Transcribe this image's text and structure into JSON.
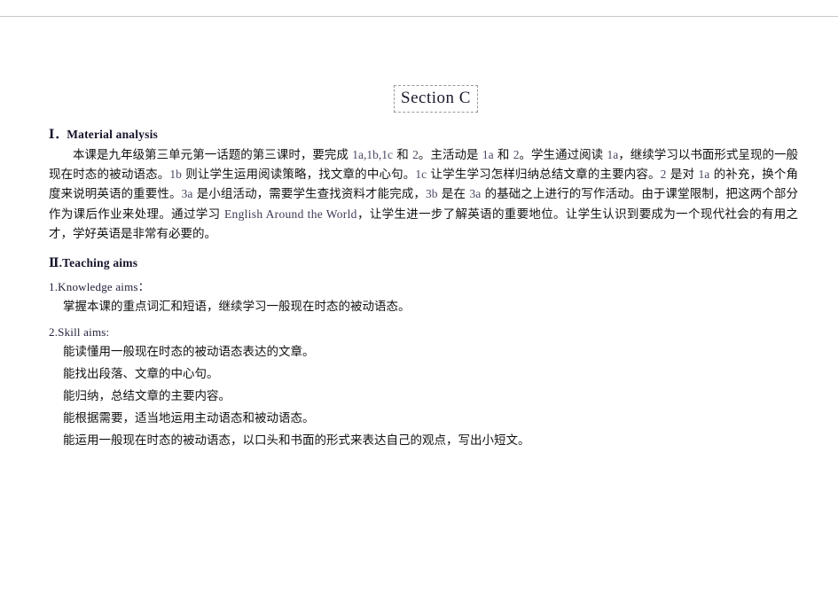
{
  "document": {
    "title_box": "Section  C",
    "sections": [
      {
        "heading": "Ⅰ．Material  analysis",
        "paragraph_html": "本课是九年级第三单元第一话题的第三课时，要完成 <span class=\"en-code\">1a,1b,1c</span>  和 <span class=\"en-code\">2</span>。主活动是 <span class=\"en-code\">1a</span> 和 <span class=\"en-code\">2</span>。学生通过阅读 <span class=\"en-code\">1a</span>，继续学习以书面形式呈现的一般现在时态的被动语态。<span class=\"en-code\">1b</span> 则让学生运用阅读策略，找文章的中心句。<span class=\"en-code\">1c</span> 让学生学习怎样归纳总结文章的主要内容。<span class=\"en-code\">2</span> 是对 <span class=\"en-code\">1a</span> 的补充，换个角度来说明英语的重要性。<span class=\"en-code\">3a</span> 是小组活动，需要学生查找资料才能完成，<span class=\"en-code\">3b</span> 是在 <span class=\"en-code\">3a</span> 的基础之上进行的写作活动。由于课堂限制，把这两个部分作为课后作业来处理。通过学习 <span class=\"en\">English  Around  the  World</span>，让学生进一步了解英语的重要地位。让学生认识到要成为一个现代社会的有用之才，学好英语是非常有必要的。",
        "paragraph_text": "本课是九年级第三单元第一话题的第三课时，要完成 1a,1b,1c 和 2。主活动是 1a 和 2。学生通过阅读 1a，继续学习以书面形式呈现的一般现在时态的被动语态。1b 则让学生运用阅读策略，找文章的中心句。1c 让学生学习怎样归纳总结文章的主要内容。2 是对 1a 的补充，换个角度来说明英语的重要性。3a 是小组活动，需要学生查找资料才能完成，3b 是在 3a 的基础之上进行的写作活动。由于课堂限制，把这两个部分作为课后作业来处理。通过学习 English Around the World，让学生进一步了解英语的重要地位。让学生认识到要成为一个现代社会的有用之才，学好英语是非常有必要的。"
      },
      {
        "heading": "Ⅱ.Teaching  aims",
        "subsections": [
          {
            "title": "1.Knowledge  aims：",
            "items": [
              "掌握本课的重点词汇和短语，继续学习一般现在时态的被动语态。"
            ]
          },
          {
            "title": "2.Skill  aims:",
            "items": [
              "能读懂用一般现在时态的被动语态表达的文章。",
              "能找出段落、文章的中心句。",
              "能归纳，总结文章的主要内容。",
              "能根据需要，适当地运用主动语态和被动语态。",
              "能运用一般现在时态的被动语态，以口头和书面的形式来表达自己的观点，写出小短文。"
            ]
          }
        ]
      }
    ]
  }
}
